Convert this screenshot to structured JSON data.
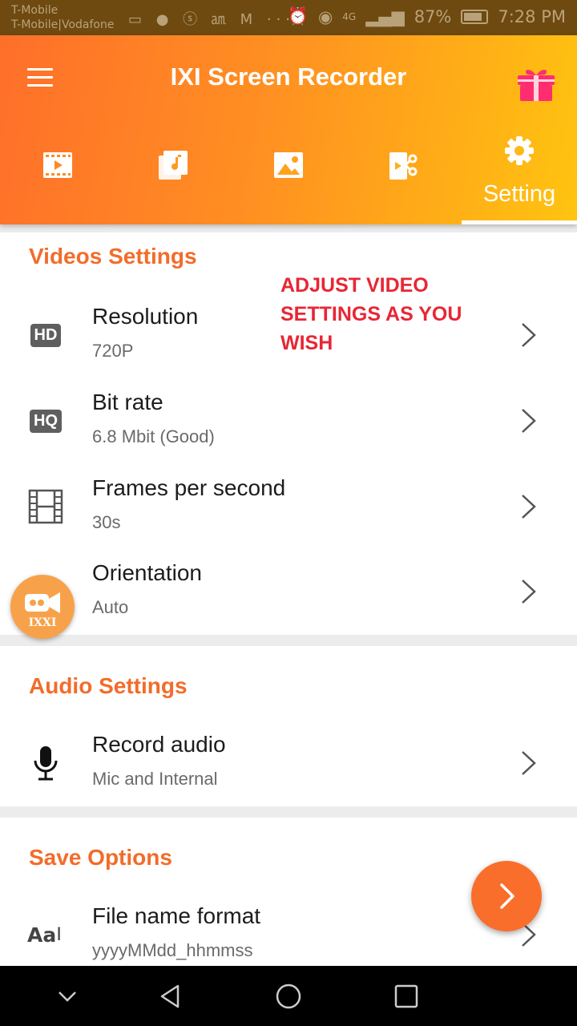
{
  "status_bar": {
    "carrier_1": "T-Mobile",
    "carrier_2": "T-Mobile|Vodafone",
    "notification_icons": "▭ ● ⓢ ㏂ M ···",
    "signal": "4G",
    "battery": "87%",
    "time": "7:28 PM"
  },
  "header": {
    "title": "IXI Screen Recorder",
    "gradient_start": "#ff6f2a",
    "gradient_end": "#ffc410"
  },
  "tabs": [
    {
      "icon": "video-icon",
      "label": ""
    },
    {
      "icon": "music-icon",
      "label": ""
    },
    {
      "icon": "image-icon",
      "label": ""
    },
    {
      "icon": "video-edit-icon",
      "label": ""
    },
    {
      "icon": "gear-icon",
      "label": "Setting",
      "active": true
    }
  ],
  "annotation": {
    "line_1": "ADJUST VIDEO",
    "line_2": "SETTINGS AS YOU",
    "line_3": "WISH"
  },
  "videos_settings": {
    "title": "Videos Settings",
    "resolution": {
      "badge": "HD",
      "label": "Resolution",
      "value": "720P"
    },
    "bitrate": {
      "badge": "HQ",
      "label": "Bit rate",
      "value": "6.8 Mbit (Good)"
    },
    "fps": {
      "label": "Frames per second",
      "value": "30s"
    },
    "orientation": {
      "label": "Orientation",
      "value": "Auto"
    }
  },
  "audio_settings": {
    "title": "Audio Settings",
    "record_audio": {
      "label": "Record audio",
      "value": "Mic and Internal"
    }
  },
  "save_options": {
    "title": "Save Options",
    "file_name": {
      "icon_text": "Aa",
      "label": "File name format",
      "value": "yyyyMMdd_hhmmss"
    }
  },
  "floating_logo": {
    "text": "IXXI"
  },
  "colors": {
    "accent": "#f26c2a",
    "annotation": "#e82634",
    "fab": "#fa6e2c"
  }
}
